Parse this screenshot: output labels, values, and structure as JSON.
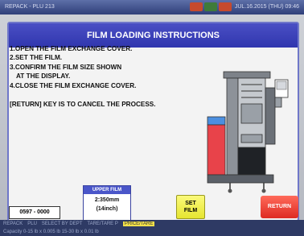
{
  "status_bar": {
    "left_text": "REPACK - PLU 213",
    "right_text": "JUL.16.2015 (THU) 09:46"
  },
  "panel": {
    "title": "FILM LOADING INSTRUCTIONS"
  },
  "instructions": {
    "steps": [
      "1.OPEN THE FILM EXCHANGE COVER.",
      "2.SET THE FILM.",
      "3.CONFIRM THE FILM SIZE SHOWN",
      "AT THE DISPLAY.",
      "4.CLOSE THE FILM EXCHANGE COVER."
    ],
    "note": "[RETURN] KEY IS TO CANCEL THE PROCESS."
  },
  "counter": {
    "value": "0597 - 0000"
  },
  "film": {
    "label": "UPPER FILM",
    "size_mm": "2:350mm",
    "size_inch": "(14inch)"
  },
  "buttons": {
    "set_line1": "SET",
    "set_line2": "FILM",
    "return_label": "RETURN"
  },
  "bottom_bar": {
    "items": [
      "REPACK",
      "PLU",
      "SELECT BY DEPT",
      "TARE/TARE P",
      "PRICE/TARE"
    ],
    "capacity": "Capacity 0-15 lb x 0.005 lb 15-30 lb x 0.01 lb"
  },
  "colors": {
    "title_bar": "#3a3fb8",
    "set_button": "#f2f156",
    "return_button": "#ef3c33",
    "machine_red": "#e8434a",
    "machine_blue": "#4b8fe0"
  }
}
